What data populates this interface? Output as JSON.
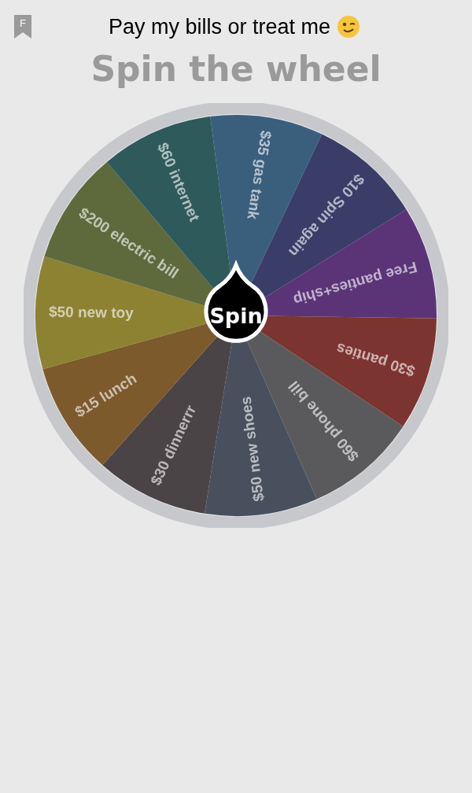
{
  "header": {
    "badge": "F",
    "title": "Pay my bills or treat me"
  },
  "heading": "Spin the wheel",
  "wheel": {
    "button": "Spin",
    "segments": [
      {
        "label": "$35 gas tank",
        "color": "#3a5f7c"
      },
      {
        "label": "$10 Spin again",
        "color": "#3a3d68"
      },
      {
        "label": "Free panties+ship",
        "color": "#5b3478"
      },
      {
        "label": "$30 panties",
        "color": "#7c3430"
      },
      {
        "label": "$60 phone bill",
        "color": "#5a5a5c"
      },
      {
        "label": "$50 new shoes",
        "color": "#48505e"
      },
      {
        "label": "$30 dinnerrr",
        "color": "#4a4446"
      },
      {
        "label": "$15 lunch",
        "color": "#7c5a2c"
      },
      {
        "label": "$50 new toy",
        "color": "#8c8232"
      },
      {
        "label": "$200 electric bill",
        "color": "#5e6a3c"
      },
      {
        "label": "$60 internet",
        "color": "#2e5a5c"
      }
    ]
  }
}
